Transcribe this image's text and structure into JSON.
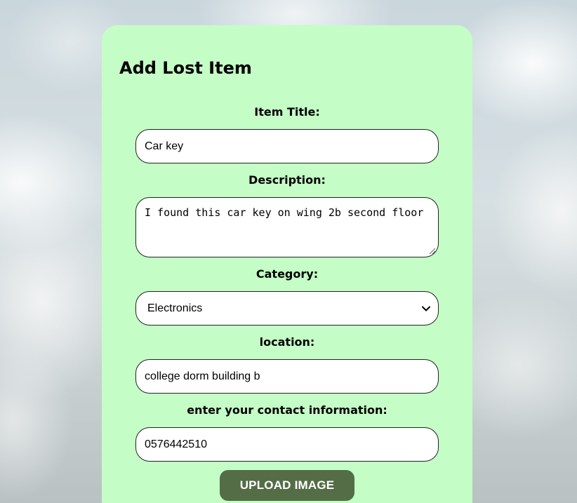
{
  "form": {
    "title": "Add Lost Item",
    "fields": {
      "title": {
        "label": "Item Title:",
        "value": "Car key"
      },
      "description": {
        "label": "Description:",
        "value": "I found this car key on wing 2b second floor"
      },
      "category": {
        "label": "Category:",
        "value": "Electronics"
      },
      "location": {
        "label": "location:",
        "value": "college dorm building b"
      },
      "contact": {
        "label": "enter your contact information:",
        "value": "0576442510"
      }
    },
    "upload_button": "UPLOAD IMAGE"
  },
  "colors": {
    "card_background": "#c4fdc6",
    "button_background": "#546d47",
    "button_text": "#ffffff"
  },
  "icons": {
    "select_arrow": "chevron-down-icon",
    "textarea_grip": "resize-grip-icon"
  }
}
